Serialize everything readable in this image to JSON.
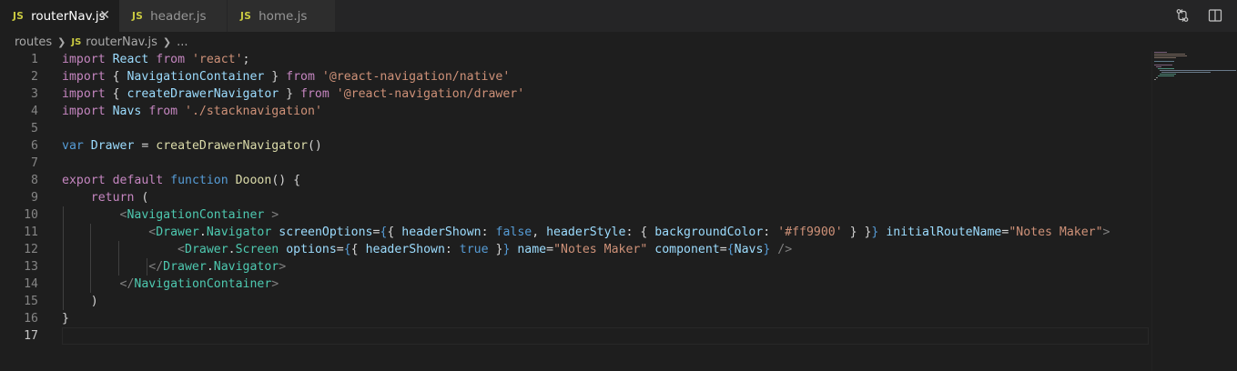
{
  "tabs": [
    {
      "lang": "JS",
      "label": "routerNav.js",
      "active": true,
      "close": "✕"
    },
    {
      "lang": "JS",
      "label": "header.js",
      "active": false
    },
    {
      "lang": "JS",
      "label": "home.js",
      "active": false
    }
  ],
  "breadcrumb": {
    "folder": "routes",
    "lang": "JS",
    "file": "routerNav.js",
    "more": "..."
  },
  "editor": {
    "line_numbers": [
      "1",
      "2",
      "3",
      "4",
      "5",
      "6",
      "7",
      "8",
      "9",
      "10",
      "11",
      "12",
      "13",
      "14",
      "15",
      "16",
      "17"
    ],
    "current_line": "17"
  },
  "toolbar_icons": [
    "compare-changes-icon",
    "split-editor-icon"
  ],
  "colors": {
    "keyword": "#c586c0",
    "string": "#ce9178",
    "variable": "#9cdcfe",
    "function": "#dcdcaa",
    "constant": "#569cd6",
    "component": "#4ec9b0",
    "tag_bracket": "#808080",
    "js_badge": "#cbcb41"
  }
}
